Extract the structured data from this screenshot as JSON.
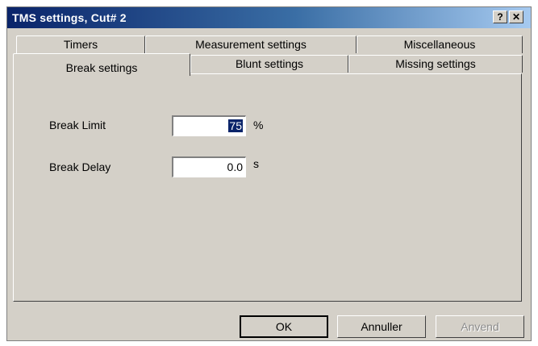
{
  "window": {
    "title": "TMS settings, Cut# 2",
    "help_label": "?",
    "close_label": "✕"
  },
  "tabs": {
    "back_row": [
      {
        "label": "Timers"
      },
      {
        "label": "Measurement settings"
      },
      {
        "label": "Miscellaneous"
      }
    ],
    "front_row": [
      {
        "label": "Break settings",
        "selected": true
      },
      {
        "label": "Blunt settings"
      },
      {
        "label": "Missing settings"
      }
    ]
  },
  "fields": {
    "break_limit": {
      "label": "Break Limit",
      "value": "75",
      "unit": "%"
    },
    "break_delay": {
      "label": "Break Delay",
      "value": "0.0",
      "unit": "s"
    }
  },
  "buttons": {
    "ok": "OK",
    "cancel": "Annuller",
    "apply": "Anvend"
  },
  "colors": {
    "titlebar_start": "#0a246a",
    "titlebar_end": "#a6caf0",
    "dialog_face": "#d4d0c8",
    "selection": "#0a246a"
  }
}
